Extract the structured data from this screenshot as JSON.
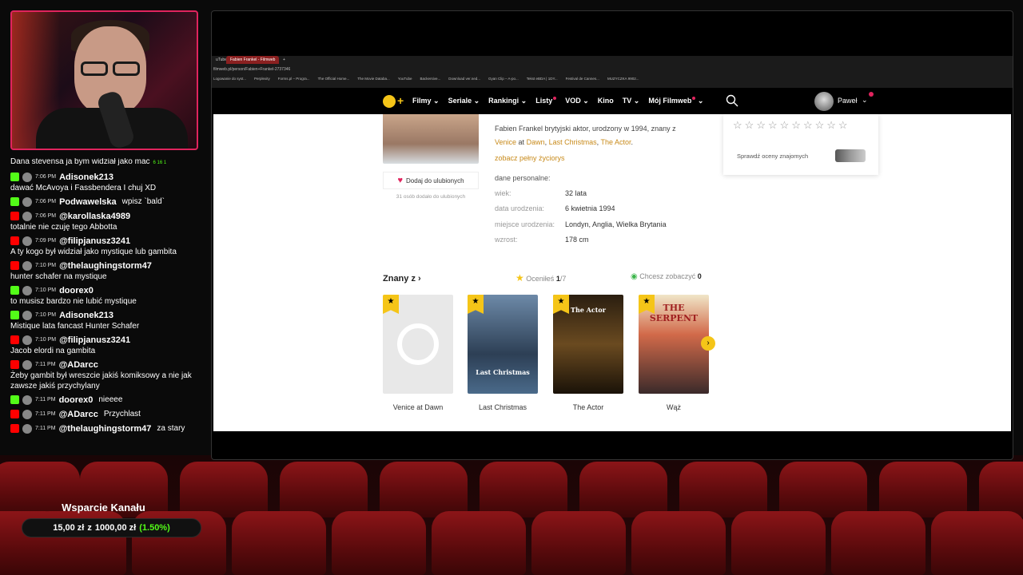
{
  "chat": [
    {
      "platform": "twitch",
      "user": "",
      "time": "",
      "text": "Dana stevensa ja bym widział jako mac",
      "inline": "",
      "badges": "6  16  1",
      "partial": true
    },
    {
      "platform": "kick",
      "user": "Adisonek213",
      "time": "7:06 PM",
      "text": "dawać McAvoya i Fassbendera I chuj XD",
      "inline": ""
    },
    {
      "platform": "kick",
      "user": "Podwawelska",
      "time": "7:06 PM",
      "text": "",
      "inline": "wpisz `bald`"
    },
    {
      "platform": "youtube",
      "user": "@karollaska4989",
      "time": "7:06 PM",
      "text": "totalnie nie czuję tego Abbotta",
      "inline": ""
    },
    {
      "platform": "youtube",
      "user": "@filipjanusz3241",
      "time": "7:09 PM",
      "text": "A ty kogo był widział jako mystique lub gambita",
      "inline": ""
    },
    {
      "platform": "youtube",
      "user": "@thelaughingstorm47",
      "time": "7:10 PM",
      "text": "hunter schafer na mystique",
      "inline": ""
    },
    {
      "platform": "kick",
      "user": "doorex0",
      "time": "7:10 PM",
      "text": "to musisz bardzo nie lubić mystique",
      "inline": ""
    },
    {
      "platform": "kick",
      "user": "Adisonek213",
      "time": "7:10 PM",
      "text": "Mistique lata fancast Hunter Schafer",
      "inline": ""
    },
    {
      "platform": "youtube",
      "user": "@filipjanusz3241",
      "time": "7:10 PM",
      "text": "Jacob elordi na gambita",
      "inline": ""
    },
    {
      "platform": "youtube",
      "user": "@ADarcc",
      "time": "7:11 PM",
      "text": "Żeby gambit był wreszcie jakiś komiksowy a nie jak zawsze jakiś przychylany",
      "inline": ""
    },
    {
      "platform": "kick",
      "user": "doorex0",
      "time": "7:11 PM",
      "text": "",
      "inline": "nieeee"
    },
    {
      "platform": "youtube",
      "user": "@ADarcc",
      "time": "7:11 PM",
      "text": "",
      "inline": "Przychlast"
    },
    {
      "platform": "youtube",
      "user": "@thelaughingstorm47",
      "time": "7:11 PM",
      "text": "",
      "inline": "za stary"
    }
  ],
  "donation": {
    "title": "Wsparcie Kanału",
    "amount": "15,00 zł",
    "of": "z",
    "goal": "1000,00 zł",
    "percent": "(1.50%)"
  },
  "browser": {
    "tab_left": "uTube",
    "tab_active": "Fabien Frankel - Filmweb",
    "new_tab": "+",
    "url": "filmweb.pl/person/Fabien+Frankel-2737346",
    "bookmarks": [
      "Logowanie do syst...",
      "Perplexity",
      "Forms.pl – Progra...",
      "The Official Home...",
      "The Movie Databa...",
      "YouTube",
      "Backersive...",
      "Download ver.ned...",
      "Gyan Clip – A-po...",
      "Tekst eBDA | 1DY...",
      "Festival de Cannes...",
      "MUZYCZKA 9902..."
    ]
  },
  "filmweb_nav": {
    "items": [
      {
        "label": "Filmy",
        "chevron": true,
        "dot": false
      },
      {
        "label": "Seriale",
        "chevron": true,
        "dot": false
      },
      {
        "label": "Rankingi",
        "chevron": true,
        "dot": false
      },
      {
        "label": "Listy",
        "chevron": false,
        "dot": true
      },
      {
        "label": "VOD",
        "chevron": true,
        "dot": false
      },
      {
        "label": "Kino",
        "chevron": false,
        "dot": false
      },
      {
        "label": "TV",
        "chevron": true,
        "dot": false
      },
      {
        "label": "Mój Filmweb",
        "chevron": true,
        "dot": true
      }
    ],
    "user": "Paweł"
  },
  "person": {
    "bio_prefix": "Fabien Frankel brytyjski aktor, urodzony w 1994, znany z",
    "bio_link1": "Venice",
    "bio_at": "at",
    "bio_link2": "Dawn",
    "bio_link3": "Last Christmas",
    "bio_link4": "The Actor",
    "full_bio": "zobacz pełny życiorys",
    "favorite_button": "Dodaj do ulubionych",
    "favorite_count": "31 osób dodało do ulubionych",
    "personal_heading": "dane personalne:",
    "personal": [
      {
        "key": "wiek:",
        "value": "32 lata"
      },
      {
        "key": "data urodzenia:",
        "value": "6 kwietnia 1994"
      },
      {
        "key": "miejsce urodzenia:",
        "value": "Londyn, Anglia, Wielka Brytania"
      },
      {
        "key": "wzrost:",
        "value": "178 cm"
      }
    ]
  },
  "rating_box": {
    "stars_total": 10,
    "friends_label": "Sprawdź oceny znajomych"
  },
  "known_for": {
    "heading": "Znany z",
    "rated_label": "Oceniłeś",
    "rated_count": "1",
    "rated_total": "/7",
    "want_label": "Chcesz zobaczyć",
    "want_count": "0",
    "titles": [
      "Venice at Dawn",
      "Last Christmas",
      "The Actor",
      "Wąż"
    ],
    "poster_texts": [
      "",
      "Last Christmas",
      "The Actor",
      "THE SERPENT"
    ]
  }
}
